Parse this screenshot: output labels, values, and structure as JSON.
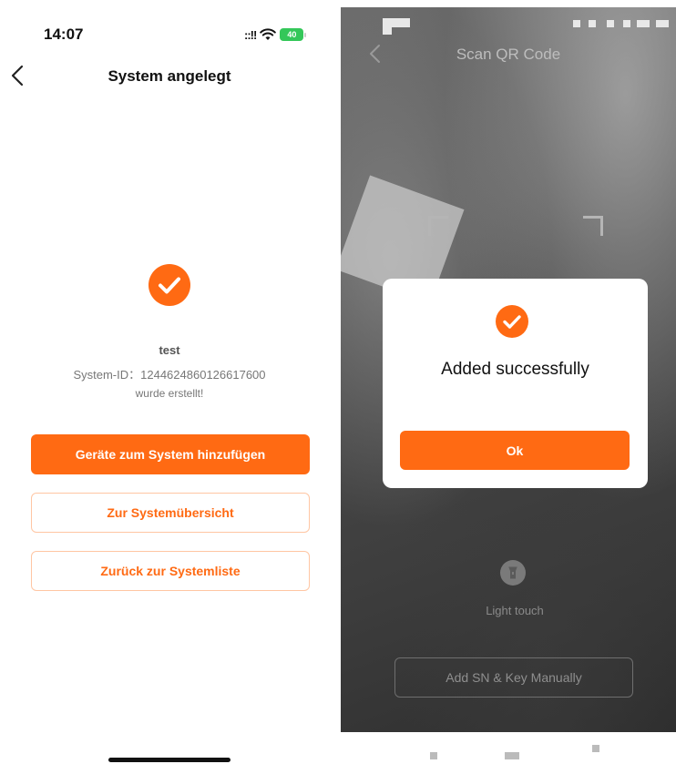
{
  "left": {
    "status_time": "14:07",
    "signal": "::!!",
    "battery": "40",
    "nav_title": "System angelegt",
    "system_name": "test",
    "system_id_text": "System-ID：1244624860126617600",
    "created_text": "wurde erstellt!",
    "buttons": {
      "add_devices": "Geräte zum System hinzufügen",
      "overview": "Zur Systemübersicht",
      "back_to_list": "Zurück zur Systemliste"
    },
    "colors": {
      "accent": "#ff6a13",
      "accent_border": "#ffc6a3"
    },
    "icons": {
      "back": "chevron-left-icon",
      "success": "check-circle-icon"
    }
  },
  "right": {
    "nav_title": "Scan QR Code",
    "torch_label": "Light touch",
    "manual_button": "Add SN & Key Manually",
    "modal": {
      "message": "Added successfully",
      "ok_label": "Ok"
    },
    "icons": {
      "back": "chevron-left-icon",
      "torch": "flashlight-icon",
      "success": "check-circle-icon"
    }
  }
}
